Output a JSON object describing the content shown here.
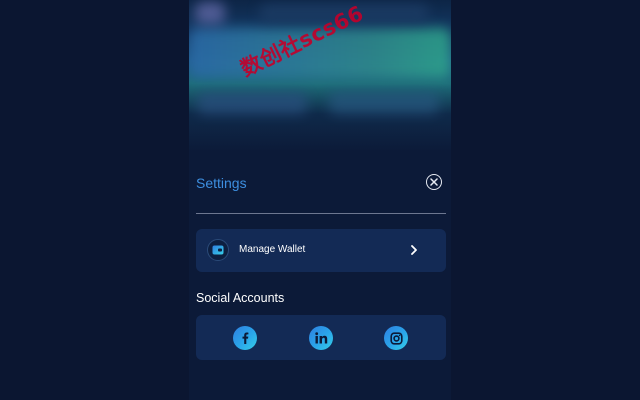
{
  "hero": {
    "watermark_text": "数创社scs66"
  },
  "settings": {
    "title": "Settings",
    "close_icon": "close-circle-icon"
  },
  "wallet": {
    "label": "Manage Wallet",
    "icon": "wallet-icon",
    "chevron_icon": "chevron-right-icon"
  },
  "social": {
    "title": "Social Accounts",
    "items": [
      {
        "name": "facebook",
        "icon": "facebook-icon"
      },
      {
        "name": "linkedin",
        "icon": "linkedin-icon"
      },
      {
        "name": "instagram",
        "icon": "instagram-icon"
      }
    ]
  },
  "colors": {
    "page_background": "#0b1631",
    "card_background": "#132a55",
    "accent_blue": "#3d8fe0",
    "watermark_red": "#c3002a"
  }
}
